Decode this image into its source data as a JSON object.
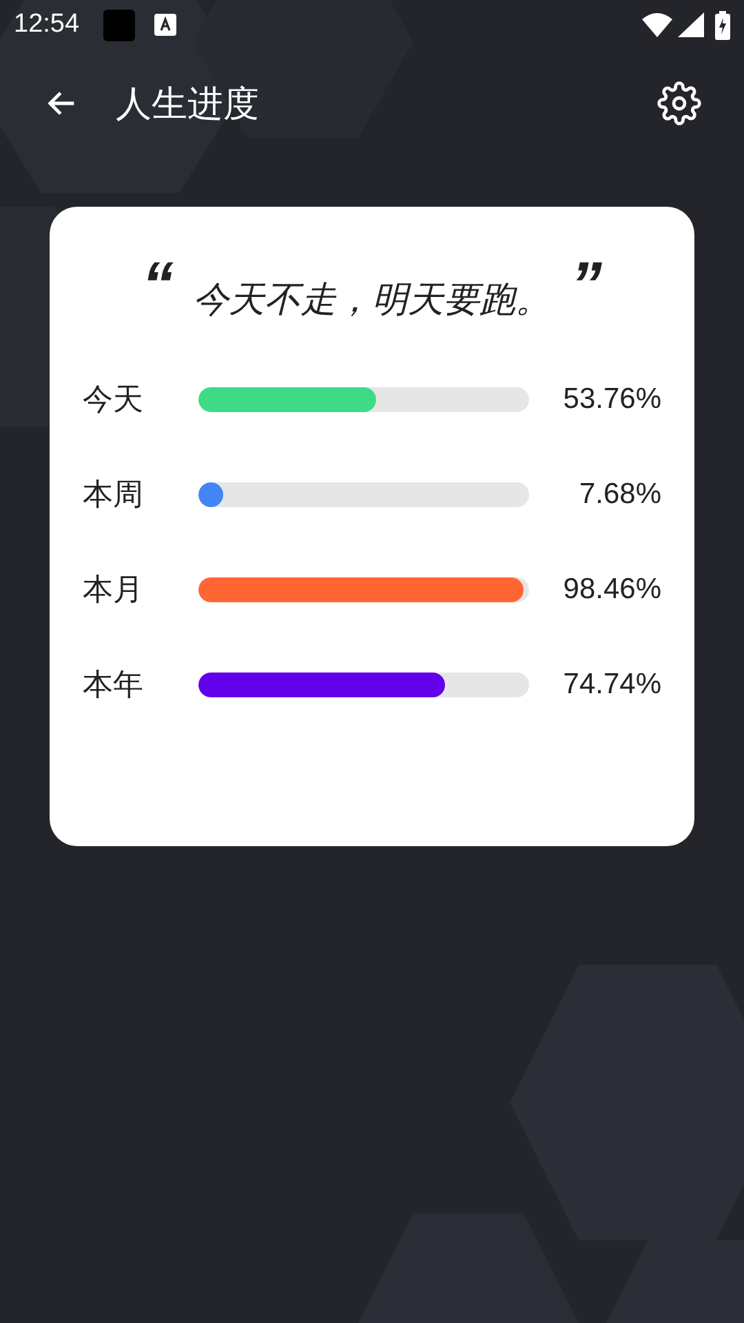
{
  "status_bar": {
    "time": "12:54"
  },
  "app_bar": {
    "title": "人生进度"
  },
  "card": {
    "quote_open": "“",
    "quote": "今天不走，明天要跑。",
    "quote_close": "”",
    "rows": [
      {
        "label": "今天",
        "level": 0.5376,
        "reading": "53.76%",
        "color": "#3ddc84"
      },
      {
        "label": "本周",
        "level": 0.0768,
        "reading": "7.68%",
        "color": "#4285f4"
      },
      {
        "label": "本月",
        "level": 0.9846,
        "reading": "98.46%",
        "color": "#ff6633"
      },
      {
        "label": "本年",
        "level": 0.7474,
        "reading": "74.74%",
        "color": "#6200ea"
      }
    ]
  }
}
